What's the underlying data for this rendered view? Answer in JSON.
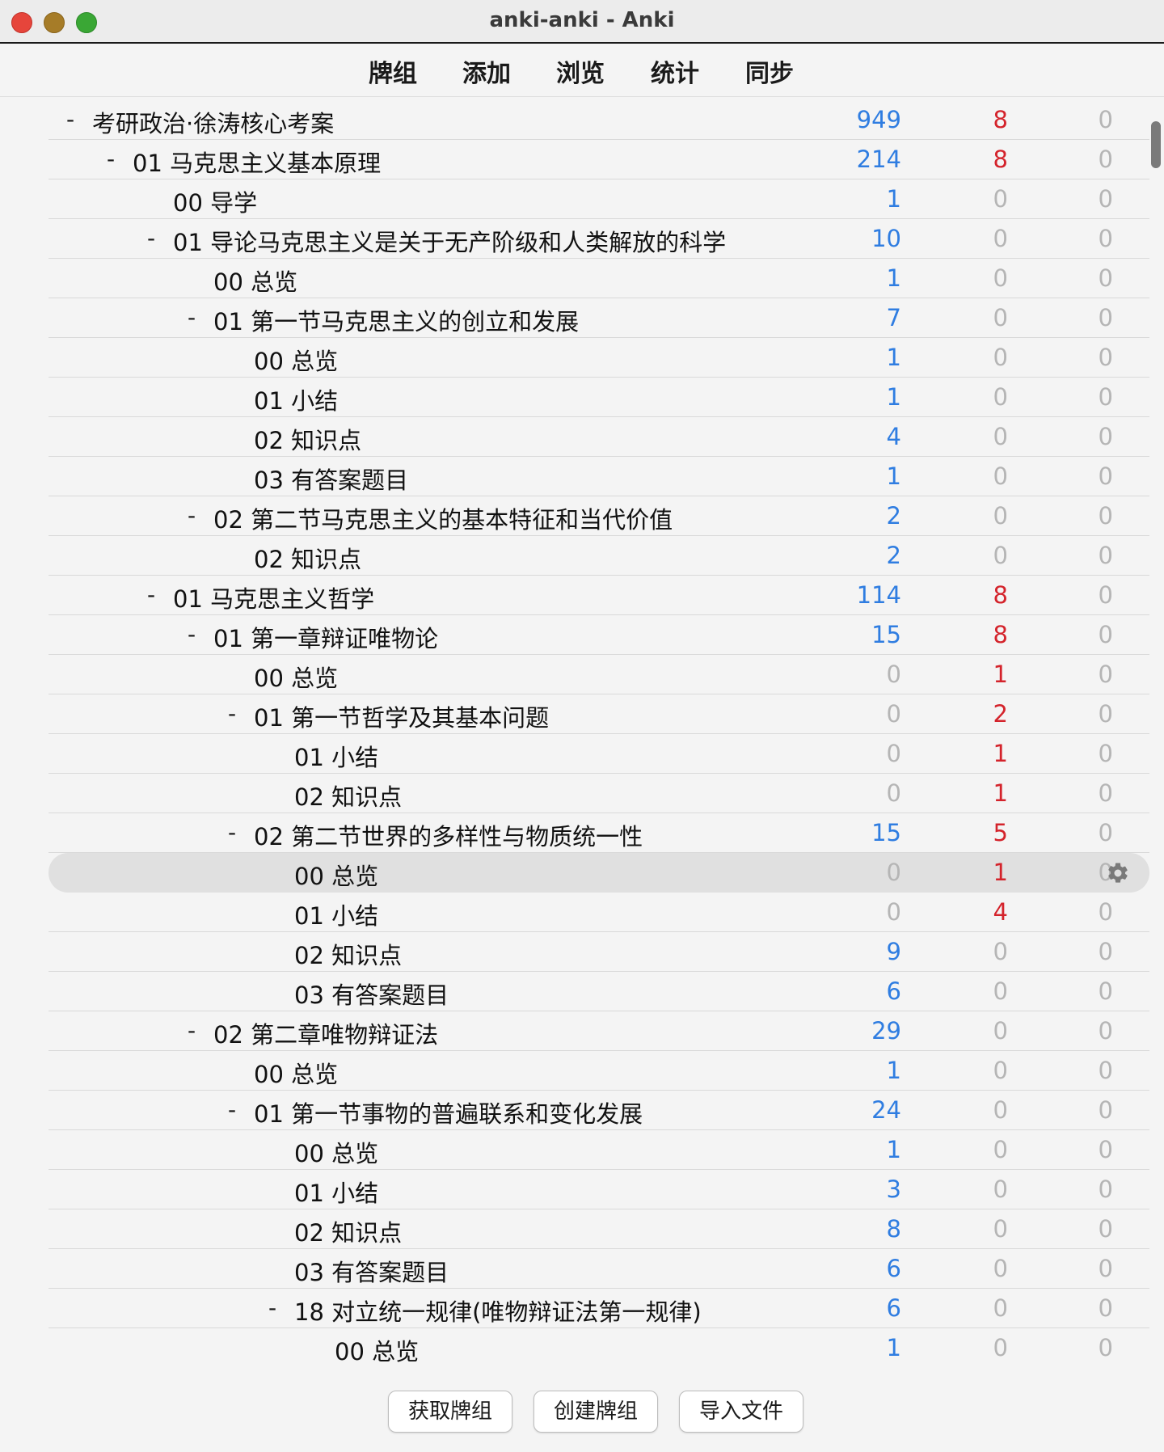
{
  "window": {
    "title": "anki-anki - Anki"
  },
  "toolbar": {
    "decks_label": "牌组",
    "add_label": "添加",
    "browse_label": "浏览",
    "stats_label": "统计",
    "sync_label": "同步"
  },
  "decks": [
    {
      "name": "考研政治·徐涛核心考案",
      "depth": 0,
      "collapsible": true,
      "new": "949",
      "learn": "8",
      "due": "0"
    },
    {
      "name": "01 马克思主义基本原理",
      "depth": 1,
      "collapsible": true,
      "new": "214",
      "learn": "8",
      "due": "0"
    },
    {
      "name": "00 导学",
      "depth": 2,
      "collapsible": false,
      "new": "1",
      "learn": "0",
      "due": "0"
    },
    {
      "name": "01 导论马克思主义是关于无产阶级和人类解放的科学",
      "depth": 2,
      "collapsible": true,
      "new": "10",
      "learn": "0",
      "due": "0"
    },
    {
      "name": "00 总览",
      "depth": 3,
      "collapsible": false,
      "new": "1",
      "learn": "0",
      "due": "0"
    },
    {
      "name": "01 第一节马克思主义的创立和发展",
      "depth": 3,
      "collapsible": true,
      "new": "7",
      "learn": "0",
      "due": "0"
    },
    {
      "name": "00 总览",
      "depth": 4,
      "collapsible": false,
      "new": "1",
      "learn": "0",
      "due": "0"
    },
    {
      "name": "01 小结",
      "depth": 4,
      "collapsible": false,
      "new": "1",
      "learn": "0",
      "due": "0"
    },
    {
      "name": "02 知识点",
      "depth": 4,
      "collapsible": false,
      "new": "4",
      "learn": "0",
      "due": "0"
    },
    {
      "name": "03 有答案题目",
      "depth": 4,
      "collapsible": false,
      "new": "1",
      "learn": "0",
      "due": "0"
    },
    {
      "name": "02 第二节马克思主义的基本特征和当代价值",
      "depth": 3,
      "collapsible": true,
      "new": "2",
      "learn": "0",
      "due": "0"
    },
    {
      "name": "02 知识点",
      "depth": 4,
      "collapsible": false,
      "new": "2",
      "learn": "0",
      "due": "0"
    },
    {
      "name": "01 马克思主义哲学",
      "depth": 2,
      "collapsible": true,
      "new": "114",
      "learn": "8",
      "due": "0"
    },
    {
      "name": "01 第一章辩证唯物论",
      "depth": 3,
      "collapsible": true,
      "new": "15",
      "learn": "8",
      "due": "0"
    },
    {
      "name": "00 总览",
      "depth": 4,
      "collapsible": false,
      "new": "0",
      "learn": "1",
      "due": "0"
    },
    {
      "name": "01 第一节哲学及其基本问题",
      "depth": 4,
      "collapsible": true,
      "new": "0",
      "learn": "2",
      "due": "0"
    },
    {
      "name": "01 小结",
      "depth": 5,
      "collapsible": false,
      "new": "0",
      "learn": "1",
      "due": "0"
    },
    {
      "name": "02 知识点",
      "depth": 5,
      "collapsible": false,
      "new": "0",
      "learn": "1",
      "due": "0"
    },
    {
      "name": "02 第二节世界的多样性与物质统一性",
      "depth": 4,
      "collapsible": true,
      "new": "15",
      "learn": "5",
      "due": "0"
    },
    {
      "name": "00 总览",
      "depth": 5,
      "collapsible": false,
      "new": "0",
      "learn": "1",
      "due": "0",
      "selected": true
    },
    {
      "name": "01 小结",
      "depth": 5,
      "collapsible": false,
      "new": "0",
      "learn": "4",
      "due": "0"
    },
    {
      "name": "02 知识点",
      "depth": 5,
      "collapsible": false,
      "new": "9",
      "learn": "0",
      "due": "0"
    },
    {
      "name": "03 有答案题目",
      "depth": 5,
      "collapsible": false,
      "new": "6",
      "learn": "0",
      "due": "0"
    },
    {
      "name": "02 第二章唯物辩证法",
      "depth": 3,
      "collapsible": true,
      "new": "29",
      "learn": "0",
      "due": "0"
    },
    {
      "name": "00 总览",
      "depth": 4,
      "collapsible": false,
      "new": "1",
      "learn": "0",
      "due": "0"
    },
    {
      "name": "01 第一节事物的普遍联系和变化发展",
      "depth": 4,
      "collapsible": true,
      "new": "24",
      "learn": "0",
      "due": "0"
    },
    {
      "name": "00 总览",
      "depth": 5,
      "collapsible": false,
      "new": "1",
      "learn": "0",
      "due": "0"
    },
    {
      "name": "01 小结",
      "depth": 5,
      "collapsible": false,
      "new": "3",
      "learn": "0",
      "due": "0"
    },
    {
      "name": "02 知识点",
      "depth": 5,
      "collapsible": false,
      "new": "8",
      "learn": "0",
      "due": "0"
    },
    {
      "name": "03 有答案题目",
      "depth": 5,
      "collapsible": false,
      "new": "6",
      "learn": "0",
      "due": "0"
    },
    {
      "name": "18 对立统一规律(唯物辩证法第一规律)",
      "depth": 5,
      "collapsible": true,
      "new": "6",
      "learn": "0",
      "due": "0"
    },
    {
      "name": "00 总览",
      "depth": 6,
      "collapsible": false,
      "new": "1",
      "learn": "0",
      "due": "0"
    }
  ],
  "collapse_symbol": "-",
  "colors": {
    "new": "#2f7de1",
    "learn": "#d4232b",
    "zero": "#b5b5b5"
  },
  "icons": {
    "options": "gear-icon"
  },
  "footer": {
    "get_shared_label": "获取牌组",
    "create_deck_label": "创建牌组",
    "import_file_label": "导入文件"
  }
}
